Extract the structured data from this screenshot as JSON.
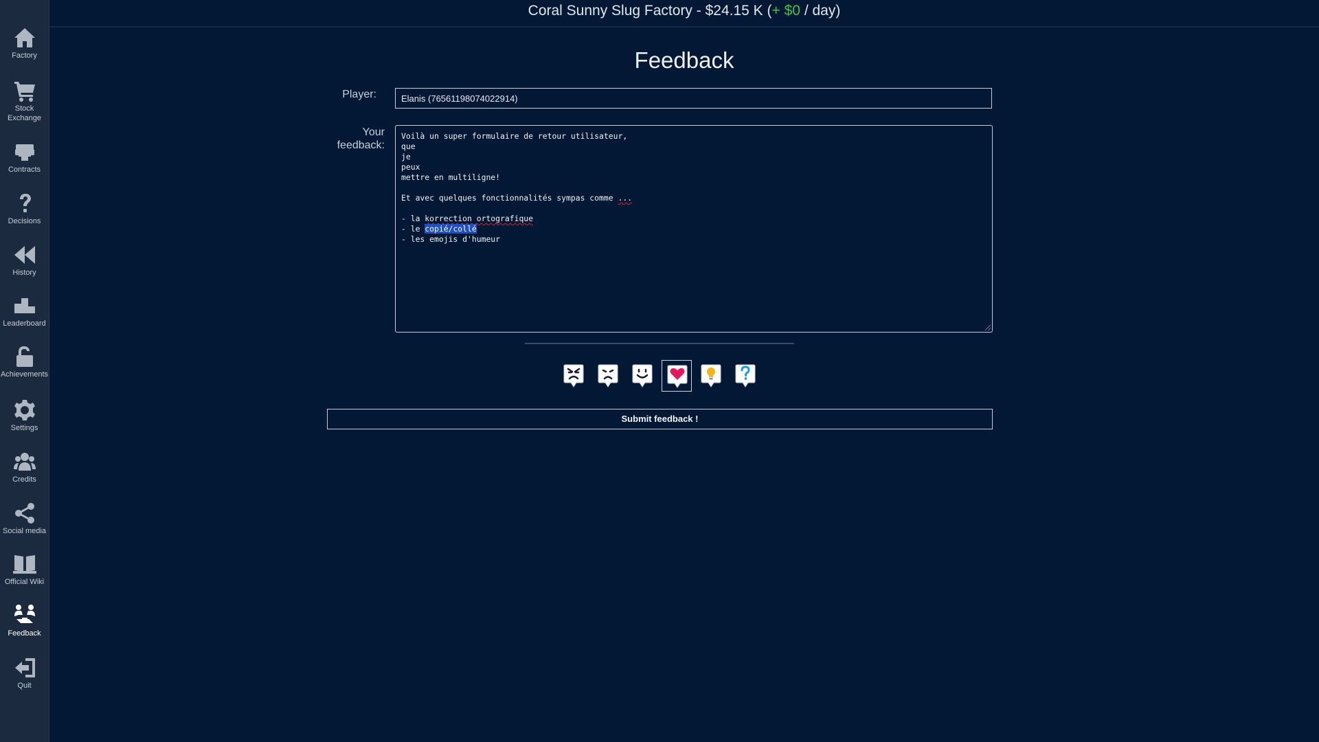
{
  "sidebar": {
    "items": [
      {
        "label": "Factory",
        "icon": "home-icon"
      },
      {
        "label": "Stock\nExchange",
        "icon": "cart-icon"
      },
      {
        "label": "Contracts",
        "icon": "contracts-icon"
      },
      {
        "label": "Decisions",
        "icon": "question-icon"
      },
      {
        "label": "History",
        "icon": "rewind-icon"
      },
      {
        "label": "Leaderboard",
        "icon": "podium-icon"
      },
      {
        "label": "Achievements",
        "icon": "lock-icon"
      },
      {
        "label": "Settings",
        "icon": "gear-icon"
      },
      {
        "label": "Credits",
        "icon": "users-icon"
      },
      {
        "label": "Social media",
        "icon": "share-icon"
      },
      {
        "label": "Official Wiki",
        "icon": "book-icon"
      },
      {
        "label": "Feedback",
        "icon": "feedback-icon"
      },
      {
        "label": "Quit",
        "icon": "quit-icon"
      }
    ],
    "active": "Feedback"
  },
  "header": {
    "factory_name": "Coral Sunny Slug Factory",
    "separator": " - ",
    "money": "$24.15 K",
    "open_paren": " (",
    "gain": "+ $0",
    "per_day": " / day)",
    "gain_color": "#41c24a"
  },
  "form": {
    "title": "Feedback",
    "player_label": "Player:",
    "player_value": "Elanis (76561198074022914)",
    "feedback_label": "Your feedback:",
    "feedback_lines": {
      "l1": "Voilà un super formulaire de retour utilisateur,",
      "l2": "que",
      "l3": "je",
      "l4": "peux",
      "l5": "mettre en multiligne!",
      "l6": "",
      "l7_text": "Et avec quelques fonctionnalités sympas comme ",
      "l7_spell": "...",
      "l8": "",
      "l9_prefix": "- la ",
      "l9_spell": "korrection ortografique",
      "l10_prefix": "- le ",
      "l10_selected": "copié/collé",
      "l11": "- les emojis d'humeur"
    },
    "moods": [
      {
        "icon": "angry-face-icon",
        "selected": false
      },
      {
        "icon": "sad-face-icon",
        "selected": false
      },
      {
        "icon": "happy-face-icon",
        "selected": false
      },
      {
        "icon": "heart-icon",
        "selected": true,
        "color": "#e8175d"
      },
      {
        "icon": "lightbulb-icon",
        "selected": false,
        "color": "#f5b412"
      },
      {
        "icon": "question-icon",
        "selected": false,
        "color": "#1e9be6"
      }
    ],
    "submit_label": "Submit feedback !"
  }
}
